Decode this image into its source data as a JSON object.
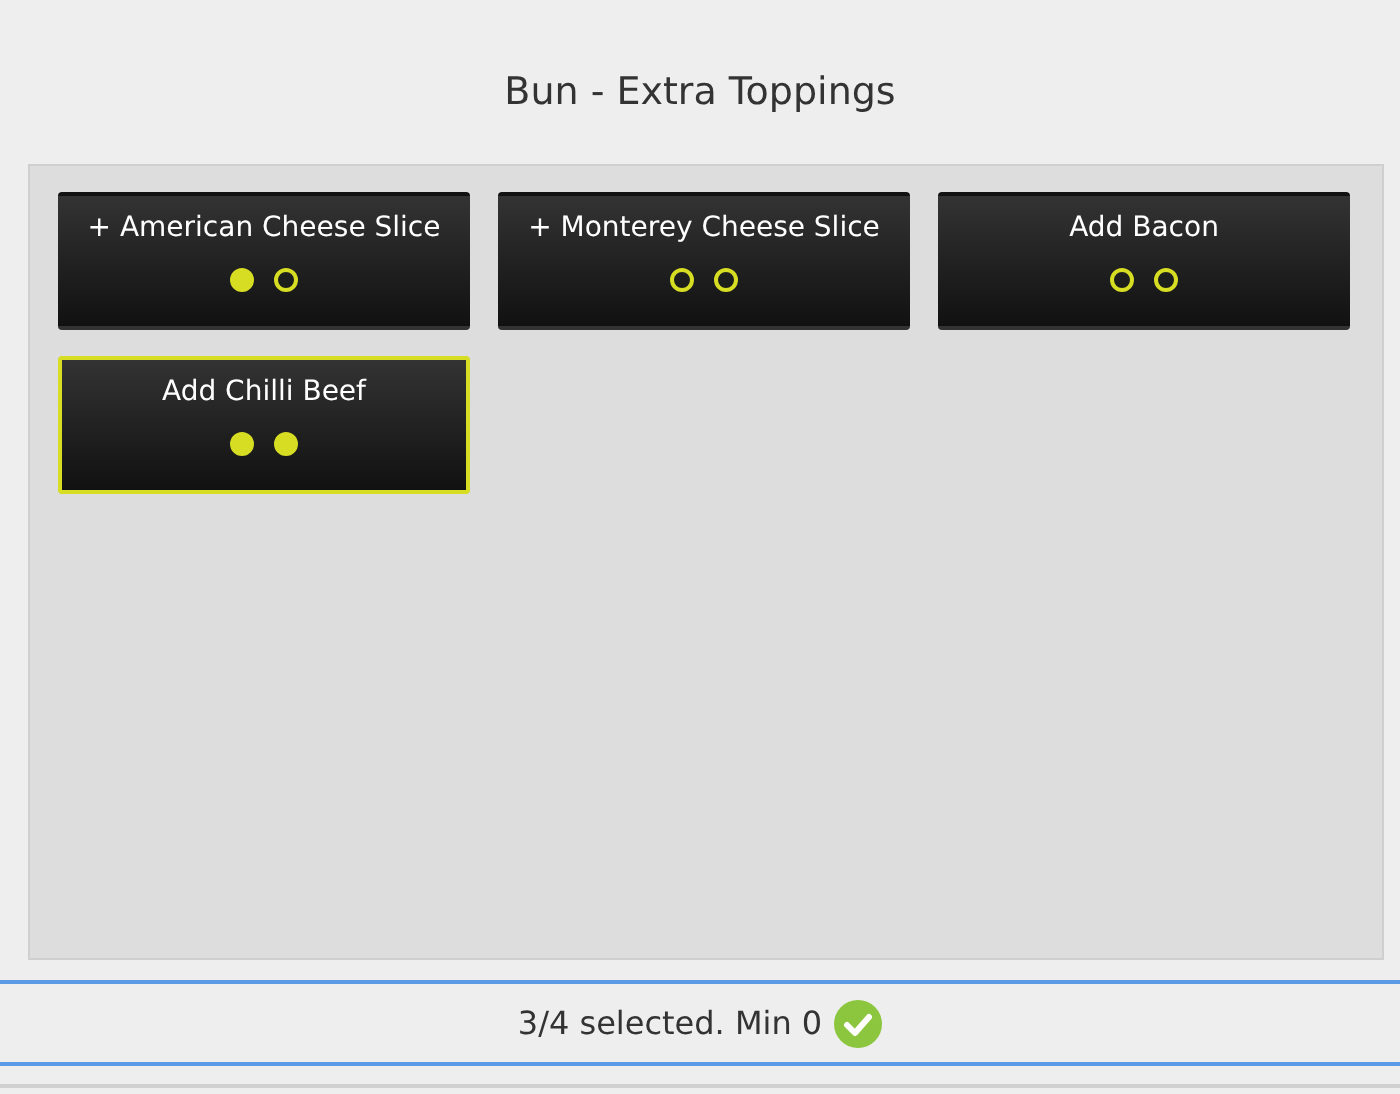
{
  "title": "Bun - Extra Toppings",
  "options": [
    {
      "label": "+ American Cheese Slice",
      "selected": false,
      "dots": [
        {
          "filled": true
        },
        {
          "filled": false
        }
      ]
    },
    {
      "label": "+ Monterey Cheese Slice",
      "selected": false,
      "dots": [
        {
          "filled": false
        },
        {
          "filled": false
        }
      ]
    },
    {
      "label": "Add Bacon",
      "selected": false,
      "dots": [
        {
          "filled": false
        },
        {
          "filled": false
        }
      ]
    },
    {
      "label": "Add Chilli Beef",
      "selected": true,
      "dots": [
        {
          "filled": true
        },
        {
          "filled": true
        }
      ]
    }
  ],
  "status": {
    "text": "3/4 selected. Min 0",
    "valid": true
  }
}
